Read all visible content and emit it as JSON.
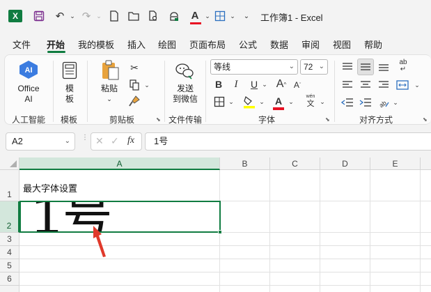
{
  "window": {
    "title": "工作簿1 - Excel",
    "app_logo": "X"
  },
  "menu": {
    "tabs": [
      "文件",
      "开始",
      "我的模板",
      "插入",
      "绘图",
      "页面布局",
      "公式",
      "数据",
      "审阅",
      "视图",
      "帮助"
    ],
    "active": "开始"
  },
  "ribbon": {
    "ai_group": {
      "button_line1": "Office",
      "button_line2": "AI",
      "label": "人工智能"
    },
    "template_group": {
      "button_line1": "模",
      "button_line2": "板",
      "label": "模板"
    },
    "clipboard_group": {
      "paste_label": "粘贴",
      "label": "剪贴板"
    },
    "transfer_group": {
      "button_line1": "发送",
      "button_line2": "到微信",
      "label": "文件传输"
    },
    "font_group": {
      "font_name": "等线",
      "font_size": "72",
      "bold": "B",
      "italic": "I",
      "underline": "U",
      "font_color_glyph": "A",
      "phonetic_glyph": "wén",
      "label": "字体"
    },
    "align_group": {
      "label": "对齐方式",
      "wrap_glyph": "ab"
    }
  },
  "formula_bar": {
    "name_box": "A2",
    "fx_label": "fx",
    "value": "1号"
  },
  "sheet": {
    "columns": [
      "A",
      "B",
      "C",
      "D",
      "E"
    ],
    "rows": [
      "1",
      "2",
      "3",
      "4",
      "5",
      "6"
    ],
    "selected_cell": "A2",
    "cells": {
      "A1": "最大字体设置",
      "A2": "1号"
    }
  },
  "colors": {
    "accent": "#107c41",
    "annotation_arrow": "#e0392b",
    "font_color_bar": "#e81123",
    "highlight_bar": "#ffff00"
  }
}
